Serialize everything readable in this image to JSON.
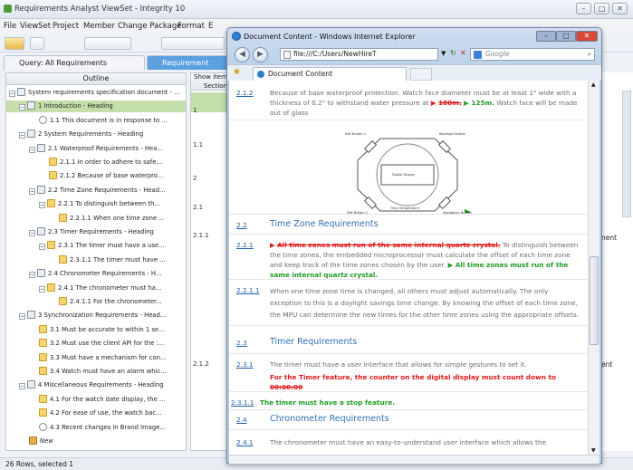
{
  "app": {
    "title": "Requirements Analyst ViewSet - Integrity 10",
    "menus": [
      "File",
      "ViewSet",
      "Project",
      "Member",
      "Change Package",
      "Format",
      "E"
    ],
    "window_buttons": [
      "–",
      "□",
      "✕"
    ],
    "tabs": [
      {
        "label": "Query: All Requirements Documents"
      },
      {
        "label": "Requirement Docum"
      }
    ],
    "outline_header": "Outline",
    "grid_header": [
      "Show item",
      "Section"
    ],
    "right_partial": [
      "nent",
      "ent"
    ],
    "status": "26 Rows, selected 1"
  },
  "outline": [
    {
      "label": "System requirements specification document - ...",
      "indent": 0,
      "icon": "doc",
      "toggle": "−",
      "sel": false
    },
    {
      "label": "1 Introduction - Heading",
      "indent": 1,
      "icon": "heading",
      "toggle": "−",
      "sel": true
    },
    {
      "label": "1.1 This document is in response to ...",
      "indent": 2,
      "icon": "comment",
      "toggle": "",
      "sel": false
    },
    {
      "label": "2 System Requirements - Heading",
      "indent": 1,
      "icon": "heading",
      "toggle": "−",
      "sel": false
    },
    {
      "label": "2.1 Waterproof Requirements - Hea...",
      "indent": 2,
      "icon": "heading",
      "toggle": "−",
      "sel": false
    },
    {
      "label": "2.1.1 In order to adhere to safe...",
      "indent": 3,
      "icon": "req",
      "toggle": "",
      "sel": false
    },
    {
      "label": "2.1.2 Because of base waterpro...",
      "indent": 3,
      "icon": "req",
      "toggle": "",
      "sel": false
    },
    {
      "label": "2.2 Time Zone Requirements - Head...",
      "indent": 2,
      "icon": "heading",
      "toggle": "−",
      "sel": false
    },
    {
      "label": "2.2.1 To distinguish between th...",
      "indent": 3,
      "icon": "req",
      "toggle": "−",
      "sel": false
    },
    {
      "label": "2.2.1.1 When one time zone ...",
      "indent": 4,
      "icon": "req",
      "toggle": "",
      "sel": false
    },
    {
      "label": "2.3 Timer Requirements - Heading",
      "indent": 2,
      "icon": "heading",
      "toggle": "−",
      "sel": false
    },
    {
      "label": "2.3.1 The timer must have a use...",
      "indent": 3,
      "icon": "req",
      "toggle": "−",
      "sel": false
    },
    {
      "label": "2.3.1.1 The timer must have ...",
      "indent": 4,
      "icon": "req",
      "toggle": "",
      "sel": false
    },
    {
      "label": "2.4 Chronometer Requirements - H...",
      "indent": 2,
      "icon": "heading",
      "toggle": "−",
      "sel": false
    },
    {
      "label": "2.4.1 The chronometer must ha...",
      "indent": 3,
      "icon": "req",
      "toggle": "−",
      "sel": false
    },
    {
      "label": "2.4.1.1 For the chronometer...",
      "indent": 4,
      "icon": "req",
      "toggle": "",
      "sel": false
    },
    {
      "label": "3 Synchronization Requirements - Head...",
      "indent": 1,
      "icon": "heading",
      "toggle": "−",
      "sel": false
    },
    {
      "label": "3.1 Must be accurate to within 1 se...",
      "indent": 2,
      "icon": "req",
      "toggle": "",
      "sel": false
    },
    {
      "label": "3.2 Must use the client API for the :...",
      "indent": 2,
      "icon": "req",
      "toggle": "",
      "sel": false
    },
    {
      "label": "3.3 Must have a mechanism for con...",
      "indent": 2,
      "icon": "req",
      "toggle": "",
      "sel": false
    },
    {
      "label": "3.4 Watch must have an alarm whic...",
      "indent": 2,
      "icon": "req",
      "toggle": "",
      "sel": false
    },
    {
      "label": "4 Miscellaneous Requirements - Heading",
      "indent": 1,
      "icon": "heading",
      "toggle": "−",
      "sel": false
    },
    {
      "label": "4.1 For the watch date display, the ...",
      "indent": 2,
      "icon": "req",
      "toggle": "",
      "sel": false
    },
    {
      "label": "4.2 For ease of use, the watch bac...",
      "indent": 2,
      "icon": "req",
      "toggle": "",
      "sel": false
    },
    {
      "label": "4.3 Recent changes in Brand Image...",
      "indent": 2,
      "icon": "comment",
      "toggle": "",
      "sel": false
    },
    {
      "label": "New",
      "indent": 1,
      "icon": "new",
      "toggle": "",
      "sel": false
    }
  ],
  "grid": [
    "1",
    "1.1",
    "2",
    "2.1",
    "2.1.1",
    "2.1.2"
  ],
  "ie": {
    "title": "Document Content - Windows Internet Explorer",
    "url": "file:///C:/Users/NewHireT",
    "search_placeholder": "Google",
    "tab": "Document Content",
    "nav": {
      "back": "◀",
      "forward": "▶"
    }
  },
  "doc": {
    "r212": {
      "num": "2.1.2",
      "a": "Because of base waterproof protection. Watch face diameter must be at least 1\" wide with a thickness of 0.2\" to withstand water pressure at ",
      "old": "100m.",
      "new": "125m.",
      "b": " Watch face will be made out of glass"
    },
    "diagram": {
      "display": "Digital Display",
      "b1": "Edit Button 1",
      "b2": "Backlight Button",
      "b3": "Edit Button 2",
      "b4": "Navigation Button",
      "tz": "Time Temperature"
    },
    "r22": {
      "num": "2.2",
      "title": "Time Zone Requirements"
    },
    "r221": {
      "num": "2.2.1",
      "del": "All time zones must run of the same internal quartz crystal.",
      "body": " To distinguish between the time zones, the embedded microprocessor must calculate the offset of each time zone and keep track of the time zones chosen by the user. ",
      "ins": "All time zones must run of the same internal quartz crystal."
    },
    "r2211": {
      "num": "2.2.1.1",
      "text": "When one time zone time is changed, all others must adjust automatically. The only exception to this is a daylight savings time change. By knowing the offset of each time zone, the MPU can determine the new times for the other time zones using the appropriate offsets."
    },
    "r23": {
      "num": "2.3",
      "title": "Timer Requirements"
    },
    "r231": {
      "num": "2.3.1",
      "text": "The timer must have a user interface that allows for simple gestures to set it.",
      "red": "For the Timer feature, the counter on the digital display must count down to ",
      "redx": "00:00:00"
    },
    "r2311": {
      "num": "2.3.1.1",
      "text": "The timer must have a stop feature."
    },
    "r24": {
      "num": "2.4",
      "title": "Chronometer Requirements"
    },
    "r241": {
      "num": "2.4.1",
      "text": "The chronometer must have an easy-to-understand user interface which allows the"
    }
  }
}
